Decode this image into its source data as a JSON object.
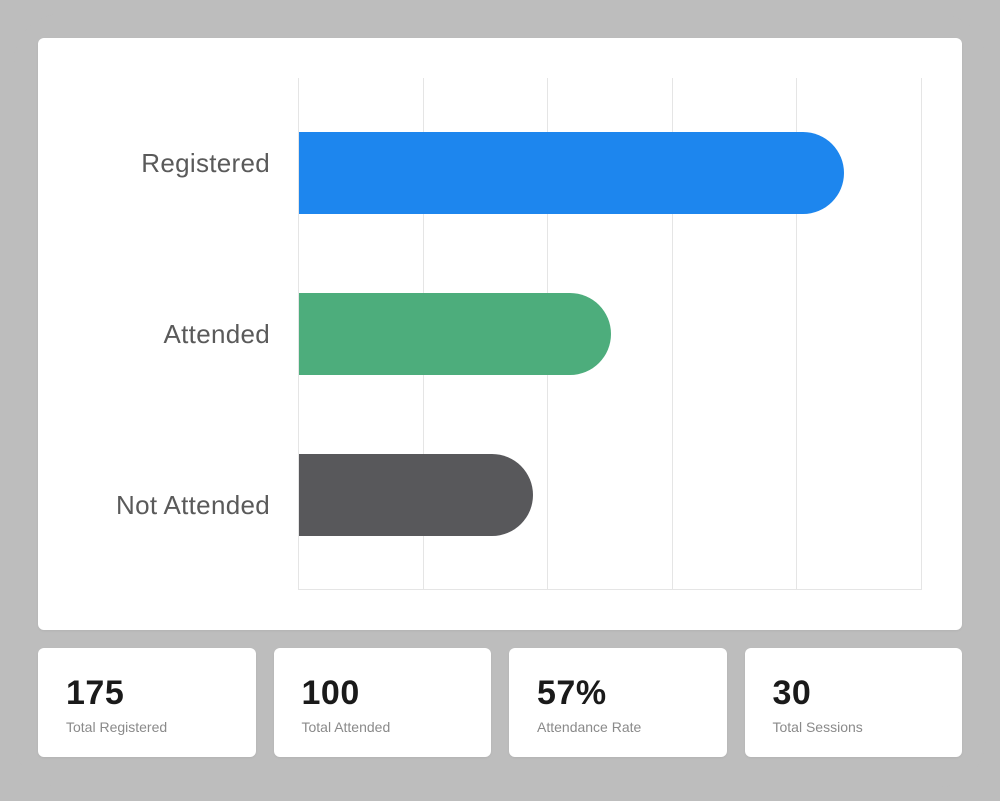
{
  "chart_data": {
    "type": "bar",
    "orientation": "horizontal",
    "categories": [
      "Registered",
      "Attended",
      "Not Attended"
    ],
    "values": [
      175,
      100,
      75
    ],
    "xlim": [
      0,
      200
    ],
    "grid_divisions": 5,
    "colors": [
      "#1d86ee",
      "#4dad7c",
      "#58585b"
    ]
  },
  "stats": [
    {
      "value": "175",
      "label": "Total Registered"
    },
    {
      "value": "100",
      "label": "Total Attended"
    },
    {
      "value": "57%",
      "label": "Attendance Rate"
    },
    {
      "value": "30",
      "label": "Total Sessions"
    }
  ]
}
